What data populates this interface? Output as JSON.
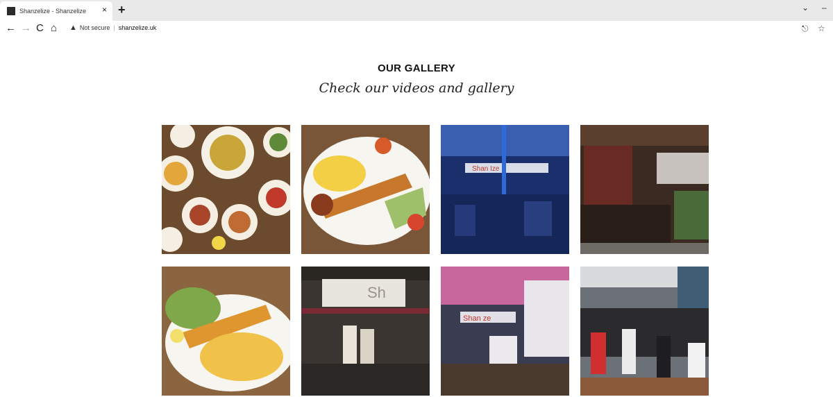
{
  "browser": {
    "tab_title": "Shanzelize - Shanzelize",
    "tab_close": "×",
    "new_tab": "+",
    "security_label": "Not secure",
    "url": "shanzelize.uk",
    "warning_glyph": "▲"
  },
  "gallery": {
    "title": "OUR GALLERY",
    "subtitle": "Check our videos and gallery",
    "images": [
      {
        "name": "mixed-meze-platters"
      },
      {
        "name": "kebab-rice-plate"
      },
      {
        "name": "blue-lit-interior"
      },
      {
        "name": "bar-interior"
      },
      {
        "name": "chicken-kebab-fries"
      },
      {
        "name": "dining-room"
      },
      {
        "name": "floral-interior"
      },
      {
        "name": "group-of-guests"
      }
    ]
  }
}
